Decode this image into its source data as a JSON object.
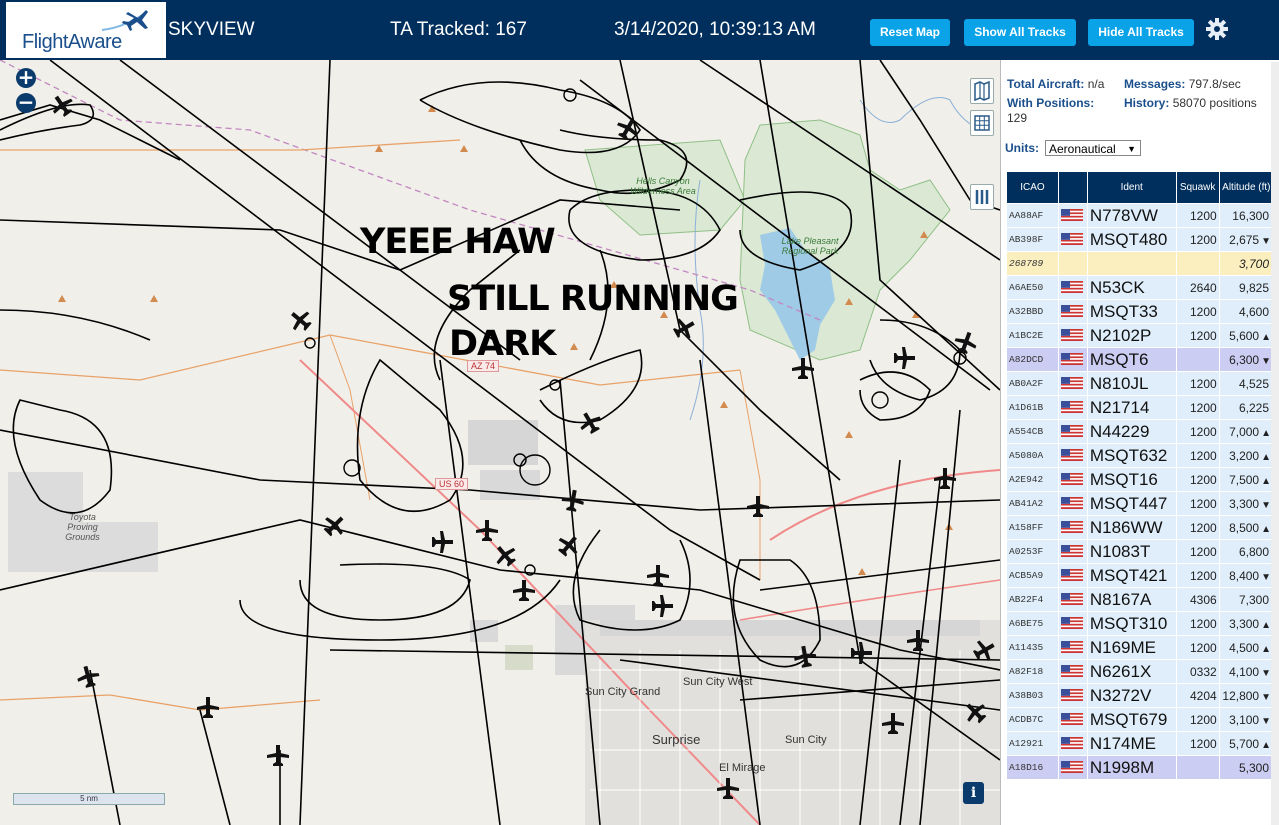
{
  "header": {
    "logo_text": "FlightAware",
    "site_name": "SKYVIEW",
    "tracked": "TA Tracked: 167",
    "datetime": "3/14/2020, 10:39:13 AM",
    "reset_label": "Reset Map",
    "show_tracks_label": "Show All Tracks",
    "hide_tracks_label": "Hide All Tracks"
  },
  "map": {
    "overlay_lines": [
      "YEEE HAW",
      "STILL RUNNING",
      "DARK"
    ],
    "labels": {
      "hells_canyon": "Hells Canyon Wilderness Area",
      "lake_pleasant": "Lake Pleasant Regional Park",
      "toyota": "Toyota Proving Grounds",
      "sun_city_grand": "Sun City Grand",
      "sun_city_west": "Sun City West",
      "surprise": "Surprise",
      "sun_city": "Sun City",
      "el_mirage": "El Mirage"
    },
    "shields": [
      "AZ 74",
      "US 60"
    ],
    "scale_label": "5 nm",
    "info_label": "i"
  },
  "stats": {
    "total_aircraft_label": "Total Aircraft:",
    "total_aircraft_value": "n/a",
    "messages_label": "Messages:",
    "messages_value": "797.8/sec",
    "with_positions_label": "With Positions:",
    "with_positions_value": "129",
    "history_label": "History:",
    "history_value": "58070 positions",
    "units_label": "Units:",
    "units_value": "Aeronautical"
  },
  "table": {
    "headers": [
      "ICAO",
      "",
      "Ident",
      "Squawk",
      "Altitude (ft)"
    ],
    "rows": [
      {
        "icao": "AA88AF",
        "ident": "N778VW",
        "squawk": "1200",
        "alt": "16,300",
        "trend": "",
        "style": ""
      },
      {
        "icao": "AB398F",
        "ident": "MSQT480",
        "squawk": "1200",
        "alt": "2,675",
        "trend": "▼",
        "style": ""
      },
      {
        "icao": "268789",
        "ident": "",
        "squawk": "",
        "alt": "3,700",
        "trend": "",
        "style": "nopos"
      },
      {
        "icao": "A6AE50",
        "ident": "N53CK",
        "squawk": "2640",
        "alt": "9,825",
        "trend": "",
        "style": ""
      },
      {
        "icao": "A32BBD",
        "ident": "MSQT33",
        "squawk": "1200",
        "alt": "4,600",
        "trend": "",
        "style": ""
      },
      {
        "icao": "A1BC2E",
        "ident": "N2102P",
        "squawk": "1200",
        "alt": "5,600",
        "trend": "▲",
        "style": ""
      },
      {
        "icao": "A82DCD",
        "ident": "MSQT6",
        "squawk": "",
        "alt": "6,300",
        "trend": "▼",
        "style": "sel"
      },
      {
        "icao": "AB0A2F",
        "ident": "N810JL",
        "squawk": "1200",
        "alt": "4,525",
        "trend": "",
        "style": ""
      },
      {
        "icao": "A1D61B",
        "ident": "N21714",
        "squawk": "1200",
        "alt": "6,225",
        "trend": "",
        "style": ""
      },
      {
        "icao": "A554CB",
        "ident": "N44229",
        "squawk": "1200",
        "alt": "7,000",
        "trend": "▲",
        "style": ""
      },
      {
        "icao": "A5080A",
        "ident": "MSQT632",
        "squawk": "1200",
        "alt": "3,200",
        "trend": "▲",
        "style": ""
      },
      {
        "icao": "A2E942",
        "ident": "MSQT16",
        "squawk": "1200",
        "alt": "7,500",
        "trend": "▲",
        "style": ""
      },
      {
        "icao": "AB41A2",
        "ident": "MSQT447",
        "squawk": "1200",
        "alt": "3,300",
        "trend": "▼",
        "style": ""
      },
      {
        "icao": "A158FF",
        "ident": "N186WW",
        "squawk": "1200",
        "alt": "8,500",
        "trend": "▲",
        "style": ""
      },
      {
        "icao": "A0253F",
        "ident": "N1083T",
        "squawk": "1200",
        "alt": "6,800",
        "trend": "",
        "style": ""
      },
      {
        "icao": "ACB5A9",
        "ident": "MSQT421",
        "squawk": "1200",
        "alt": "8,400",
        "trend": "▼",
        "style": ""
      },
      {
        "icao": "AB22F4",
        "ident": "N8167A",
        "squawk": "4306",
        "alt": "7,300",
        "trend": "",
        "style": ""
      },
      {
        "icao": "A6BE75",
        "ident": "MSQT310",
        "squawk": "1200",
        "alt": "3,300",
        "trend": "▲",
        "style": ""
      },
      {
        "icao": "A11435",
        "ident": "N169ME",
        "squawk": "1200",
        "alt": "4,500",
        "trend": "▲",
        "style": ""
      },
      {
        "icao": "A82F18",
        "ident": "N6261X",
        "squawk": "0332",
        "alt": "4,100",
        "trend": "▼",
        "style": ""
      },
      {
        "icao": "A38B03",
        "ident": "N3272V",
        "squawk": "4204",
        "alt": "12,800",
        "trend": "▼",
        "style": ""
      },
      {
        "icao": "ACDB7C",
        "ident": "MSQT679",
        "squawk": "1200",
        "alt": "3,100",
        "trend": "▼",
        "style": ""
      },
      {
        "icao": "A12921",
        "ident": "N174ME",
        "squawk": "1200",
        "alt": "5,700",
        "trend": "▲",
        "style": ""
      },
      {
        "icao": "A18D16",
        "ident": "N1998M",
        "squawk": "",
        "alt": "5,300",
        "trend": "",
        "style": "sel"
      }
    ]
  },
  "colors": {
    "header_bg": "#002f5d",
    "button_bg": "#0aa3e8",
    "row_bg": "#dfeefa",
    "row_selected": "#cbcdf2",
    "row_no_position": "#fbefc0"
  }
}
